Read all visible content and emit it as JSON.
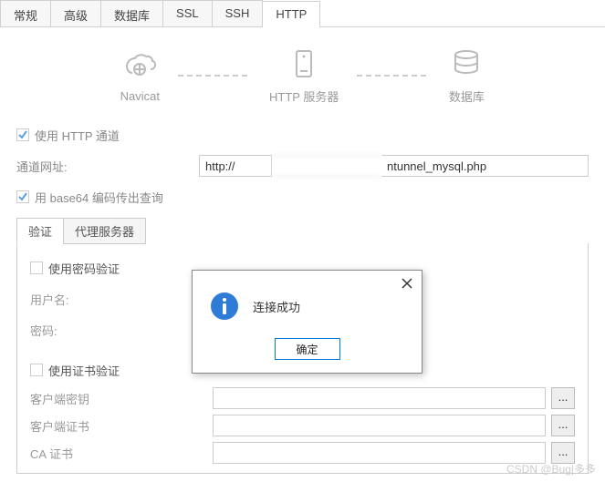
{
  "tabs": [
    "常规",
    "高级",
    "数据库",
    "SSL",
    "SSH",
    "HTTP"
  ],
  "active_tab": "HTTP",
  "diagram": {
    "navicat_label": "Navicat",
    "http_label": "HTTP 服务器",
    "db_label": "数据库"
  },
  "form": {
    "use_http_tunnel": "使用 HTTP 通道",
    "url_label": "通道网址:",
    "url_value": "http://",
    "url_suffix": "ntunnel_mysql.php",
    "base64_label": "用 base64 编码传出查询"
  },
  "subtabs": [
    "验证",
    "代理服务器"
  ],
  "active_subtab": "验证",
  "auth": {
    "use_password": "使用密码验证",
    "username_label": "用户名:",
    "password_label": "密码:",
    "use_cert": "使用证书验证",
    "client_key_label": "客户端密钥",
    "client_cert_label": "客户端证书",
    "ca_cert_label": "CA 证书",
    "dots": "..."
  },
  "dialog": {
    "message": "连接成功",
    "ok": "确定"
  },
  "watermark": "CSDN @Bug|多多"
}
